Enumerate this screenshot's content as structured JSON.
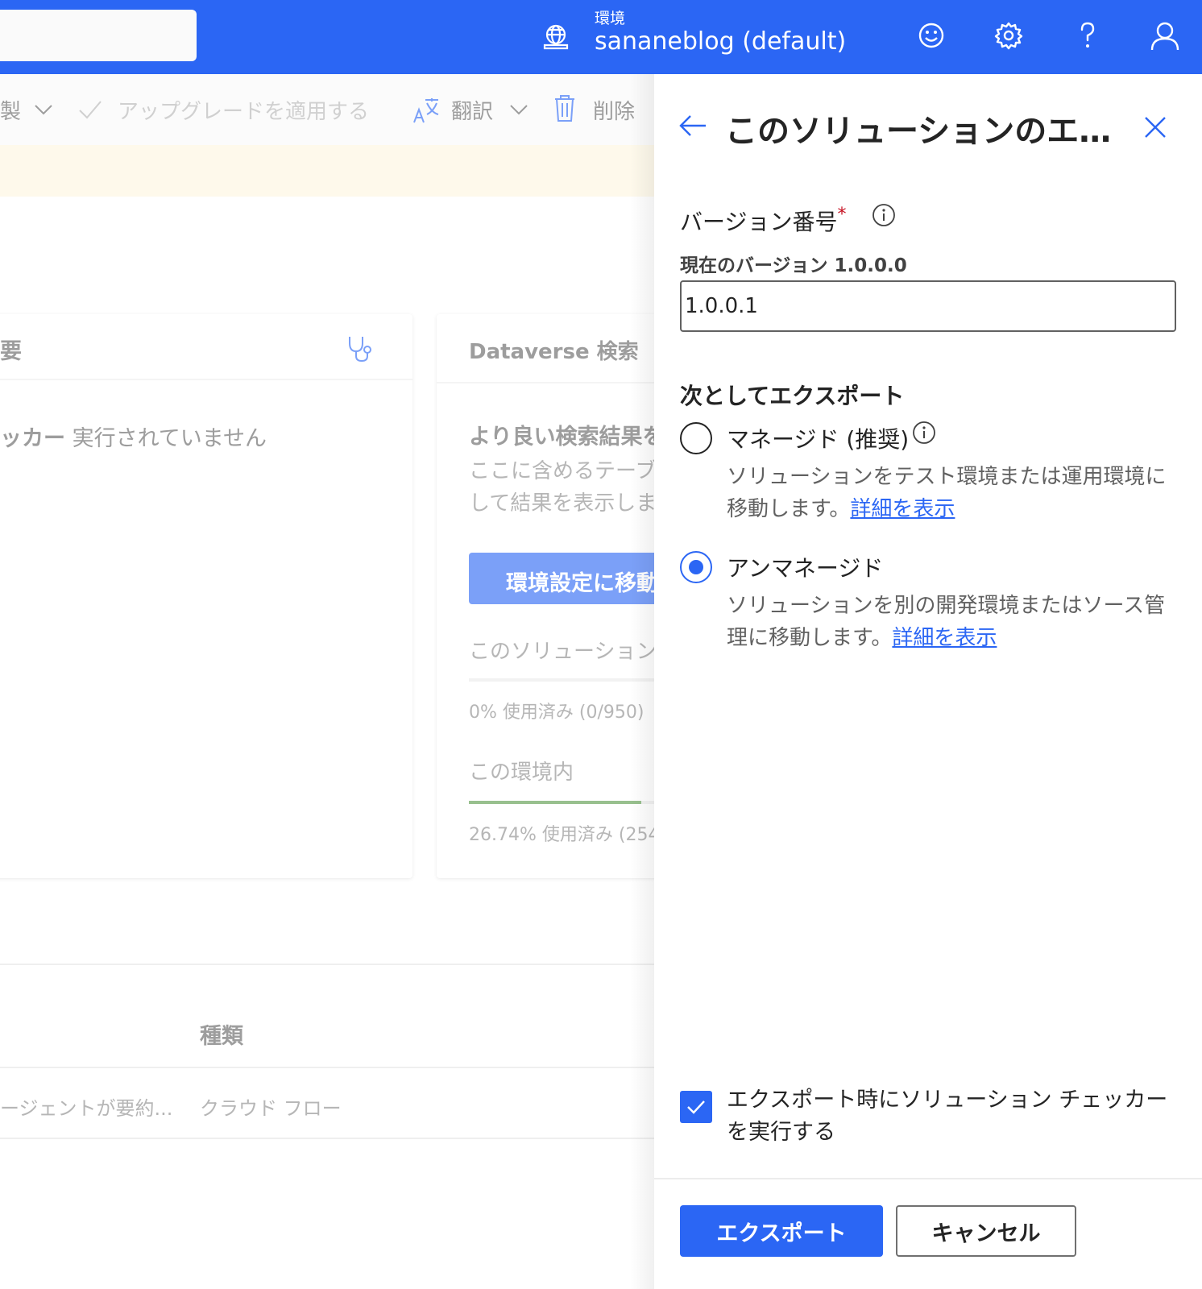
{
  "colors": {
    "brand": "#2b66f4",
    "success": "#5a9a4a",
    "required": "#c50f1f",
    "warning_bg": "#fdf6df"
  },
  "header": {
    "env_label": "環境",
    "env_name": "sananeblog (default)",
    "icons": [
      "globe-icon",
      "smiley-icon",
      "gear-icon",
      "help-icon",
      "user-icon"
    ]
  },
  "commandbar": {
    "clone_fragment": "製",
    "upgrade": "アップグレードを適用する",
    "translate": "翻訳",
    "delete": "削除"
  },
  "health_card": {
    "title_fragment": "要",
    "checker_label": "ッカー",
    "checker_status": "実行されていません"
  },
  "search_card": {
    "title": "Dataverse 検索",
    "heading": "より良い検索結果を",
    "desc_line1": "ここに含めるテーブ",
    "desc_line2": "して結果を表示しま",
    "button": "環境設定に移動",
    "solution_label": "このソリューション",
    "solution_usage": "0% 使用済み (0/950)",
    "solution_fraction": 0,
    "env_label": "この環境内",
    "env_usage": "26.74% 使用済み (254",
    "env_fraction": 0.2674
  },
  "table": {
    "column_type": "種類",
    "row1_name": "ージェントが要約...",
    "row1_type": "クラウド フロー"
  },
  "panel": {
    "title": "このソリューションのエクスポート",
    "version_label": "バージョン番号",
    "required_mark": "*",
    "current_version": "現在のバージョン 1.0.0.0",
    "version_value": "1.0.0.1",
    "export_as_label": "次としてエクスポート",
    "managed_label": "マネージド (推奨)",
    "managed_desc": "ソリューションをテスト環境または運用環境に移動します。",
    "managed_link": "詳細を表示",
    "unmanaged_label": "アンマネージド",
    "unmanaged_desc": "ソリューションを別の開発環境またはソース管理に移動します。",
    "unmanaged_link": "詳細を表示",
    "selected_option": "unmanaged",
    "run_checker_label": "エクスポート時にソリューション チェッカーを実行する",
    "run_checker_checked": true,
    "export_button": "エクスポート",
    "cancel_button": "キャンセル"
  }
}
